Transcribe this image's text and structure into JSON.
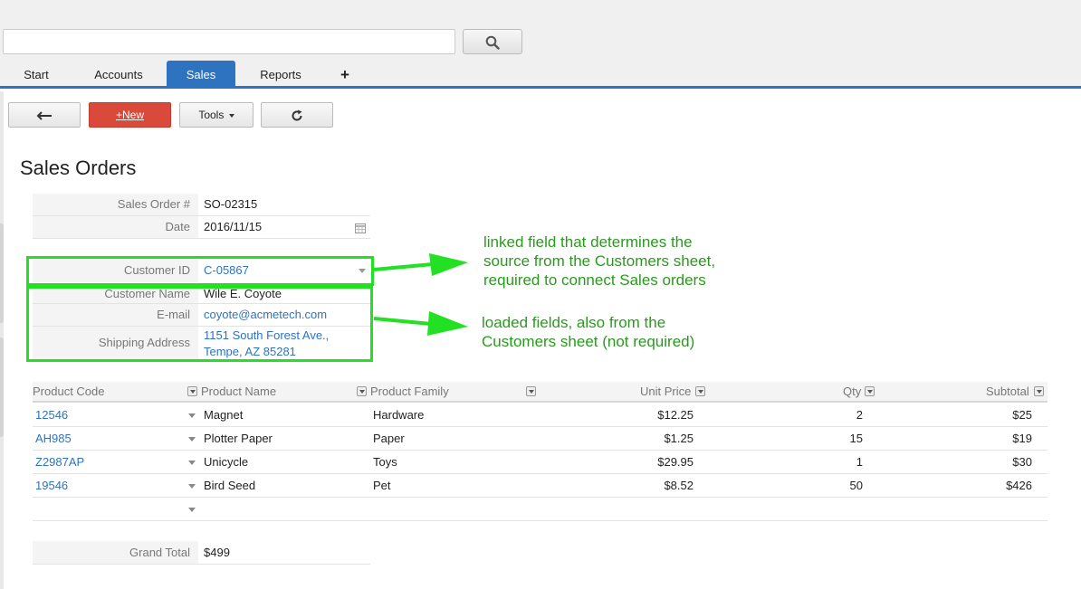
{
  "search": {
    "value": "",
    "placeholder": ""
  },
  "icons": {
    "search": "search-icon",
    "back": "arrow-left-icon",
    "refresh": "refresh-icon",
    "calendar": "calendar-icon"
  },
  "tabs": [
    {
      "label": "Start"
    },
    {
      "label": "Accounts"
    },
    {
      "label": "Sales",
      "active": true
    },
    {
      "label": "Reports"
    }
  ],
  "tab_add_label": "+",
  "toolbar": {
    "new_plus": "+",
    "new_label": "New",
    "tools_label": "Tools"
  },
  "page_title": "Sales Orders",
  "form": {
    "sales_order_label": "Sales Order #",
    "sales_order_value": "SO-02315",
    "date_label": "Date",
    "date_value": "2016/11/15",
    "customer_id_label": "Customer ID",
    "customer_id_value": "C-05867",
    "customer_name_label": "Customer Name",
    "customer_name_value": "Wile E. Coyote",
    "email_label": "E-mail",
    "email_value": "coyote@acmetech.com",
    "shipping_label": "Shipping Address",
    "shipping_line1": "1151 South Forest Ave.,",
    "shipping_line2": "Tempe, AZ 85281"
  },
  "annotations": {
    "linked": [
      "linked field that determines the",
      "source from the Customers sheet,",
      "required to connect Sales orders"
    ],
    "loaded": [
      "loaded fields, also from the",
      "Customers sheet (not required)"
    ]
  },
  "grid": {
    "columns": [
      "Product Code",
      "Product Name",
      "Product Family",
      "Unit Price",
      "Qty",
      "Subtotal"
    ],
    "rows": [
      {
        "code": "12546",
        "name": "Magnet",
        "family": "Hardware",
        "price": "$12.25",
        "qty": "2",
        "subtotal": "$25"
      },
      {
        "code": "AH985",
        "name": "Plotter Paper",
        "family": "Paper",
        "price": "$1.25",
        "qty": "15",
        "subtotal": "$19"
      },
      {
        "code": "Z2987AP",
        "name": "Unicycle",
        "family": "Toys",
        "price": "$29.95",
        "qty": "1",
        "subtotal": "$30"
      },
      {
        "code": "19546",
        "name": "Bird Seed",
        "family": "Pet",
        "price": "$8.52",
        "qty": "50",
        "subtotal": "$426"
      }
    ]
  },
  "grand_total": {
    "label": "Grand Total",
    "value": "$499"
  },
  "colors": {
    "accent": "#2e73c0",
    "new_button": "#d94a3a",
    "highlight": "#22e022",
    "annotation": "#2a9a1e"
  }
}
